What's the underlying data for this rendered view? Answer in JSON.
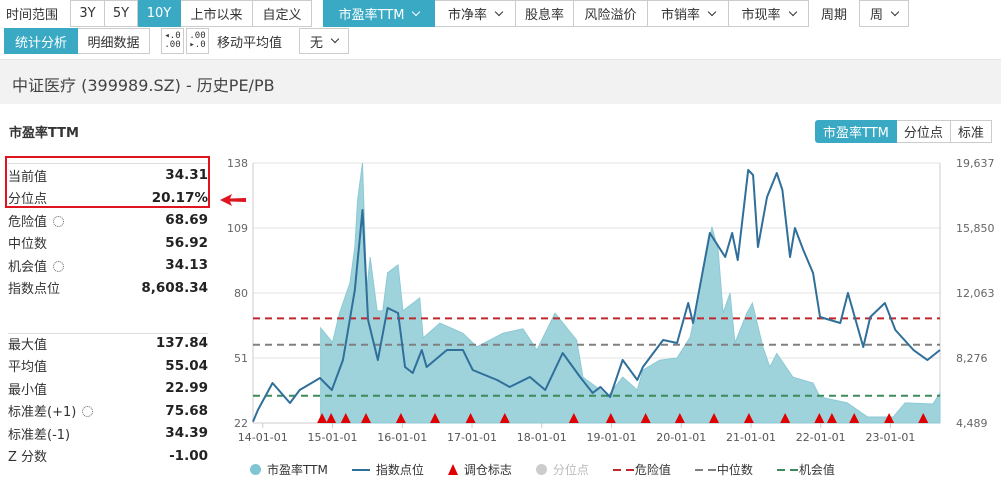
{
  "toolbar": {
    "time_range_label": "时间范围",
    "ranges": [
      "3Y",
      "5Y",
      "10Y",
      "上市以来",
      "自定义"
    ],
    "active_range": "10Y",
    "metrics": [
      "市盈率TTM",
      "市净率",
      "股息率",
      "风险溢价",
      "市销率",
      "市现率"
    ],
    "period_label": "周期",
    "period_value": "周",
    "view_tabs": [
      "统计分析",
      "明细数据"
    ],
    "decimal_increase_icon": ".0 .00",
    "decimal_decrease_icon": ".00 .0",
    "moving_avg_label": "移动平均值",
    "moving_avg_value": "无"
  },
  "header": {
    "title": "中证医疗 (399989.SZ) - 历史PE/PB"
  },
  "section_title": "市盈率TTM",
  "chart_tabs": [
    "市盈率TTM",
    "分位点",
    "标准"
  ],
  "stats": {
    "group1": [
      {
        "label": "当前值",
        "value": "34.31"
      },
      {
        "label": "分位点",
        "value": "20.17%"
      },
      {
        "label": "危险值",
        "value": "68.69",
        "gear": true
      },
      {
        "label": "中位数",
        "value": "56.92"
      },
      {
        "label": "机会值",
        "value": "34.13",
        "gear": true
      },
      {
        "label": "指数点位",
        "value": "8,608.34"
      }
    ],
    "group2": [
      {
        "label": "最大值",
        "value": "137.84"
      },
      {
        "label": "平均值",
        "value": "55.04"
      },
      {
        "label": "最小值",
        "value": "22.99"
      },
      {
        "label": "标准差(+1)",
        "value": "75.68",
        "gear": true
      },
      {
        "label": "标准差(-1)",
        "value": "34.39"
      },
      {
        "label": "Z 分数",
        "value": "-1.00"
      }
    ]
  },
  "colors": {
    "accent": "#3aa9c4",
    "pe_fill": "#9fd3dc",
    "index_line": "#2f6f9a",
    "danger": "#c0282d",
    "median": "#808080",
    "chance": "#3e8a5a",
    "marker": "#e00000",
    "highlight": "#e0141e"
  },
  "chart_data": {
    "type": "area+line",
    "x_unit": "year",
    "xlim": [
      2013.86,
      2023.71
    ],
    "x_ticks": [
      2014,
      2015,
      2016,
      2017,
      2018,
      2019,
      2020,
      2021,
      2022,
      2023
    ],
    "x_tick_labels": [
      "14-01-01",
      "15-01-01",
      "16-01-01",
      "17-01-01",
      "18-01-01",
      "19-01-01",
      "20-01-01",
      "21-01-01",
      "22-01-01",
      "23-01-01"
    ],
    "left_axis": {
      "range": [
        22,
        138
      ],
      "ticks": [
        "138",
        "109",
        "80",
        "51",
        "22"
      ],
      "tick_values": [
        138,
        109,
        80,
        51,
        22
      ]
    },
    "right_axis": {
      "range": [
        4489,
        19637
      ],
      "ticks": [
        "19,637",
        "15,850",
        "12,063",
        "8,276",
        "4,489"
      ],
      "tick_values": [
        19637,
        15850,
        12063,
        8276,
        4489
      ]
    },
    "reference_lines": {
      "danger": 68.69,
      "median": 56.92,
      "chance": 34.13
    },
    "series": [
      {
        "name": "市盈率TTM",
        "axis": "left",
        "type": "area",
        "points": [
          [
            2014.83,
            64.4
          ],
          [
            2015.0,
            58
          ],
          [
            2015.1,
            71
          ],
          [
            2015.25,
            84.5
          ],
          [
            2015.32,
            100.5
          ],
          [
            2015.36,
            121.5
          ],
          [
            2015.43,
            138
          ],
          [
            2015.49,
            81
          ],
          [
            2015.54,
            96
          ],
          [
            2015.64,
            72
          ],
          [
            2015.72,
            72
          ],
          [
            2015.79,
            89
          ],
          [
            2015.94,
            92.5
          ],
          [
            2016.01,
            72
          ],
          [
            2016.25,
            77.8
          ],
          [
            2016.3,
            60
          ],
          [
            2016.54,
            66.6
          ],
          [
            2016.87,
            62
          ],
          [
            2017.07,
            56
          ],
          [
            2017.44,
            62
          ],
          [
            2017.73,
            64
          ],
          [
            2017.93,
            54.6
          ],
          [
            2018.19,
            71
          ],
          [
            2018.5,
            59
          ],
          [
            2018.59,
            42.5
          ],
          [
            2018.84,
            36.7
          ],
          [
            2018.94,
            33.6
          ],
          [
            2019.16,
            42.5
          ],
          [
            2019.37,
            36.7
          ],
          [
            2019.45,
            45.6
          ],
          [
            2019.69,
            50
          ],
          [
            2019.94,
            51
          ],
          [
            2020.13,
            60.4
          ],
          [
            2020.27,
            82.7
          ],
          [
            2020.44,
            109.5
          ],
          [
            2020.53,
            99
          ],
          [
            2020.6,
            71
          ],
          [
            2020.7,
            80
          ],
          [
            2020.77,
            57.7
          ],
          [
            2020.94,
            71
          ],
          [
            2021.02,
            75.5
          ],
          [
            2021.17,
            56
          ],
          [
            2021.27,
            47
          ],
          [
            2021.37,
            53
          ],
          [
            2021.6,
            42.5
          ],
          [
            2021.89,
            39.8
          ],
          [
            2021.99,
            33.6
          ],
          [
            2022.38,
            31
          ],
          [
            2022.67,
            24.7
          ],
          [
            2023.04,
            24.7
          ],
          [
            2023.21,
            31
          ],
          [
            2023.61,
            30.5
          ],
          [
            2023.71,
            35.4
          ]
        ]
      },
      {
        "name": "指数点位",
        "axis": "right",
        "type": "line",
        "points": [
          [
            2013.86,
            4565
          ],
          [
            2013.93,
            5246
          ],
          [
            2014.14,
            6820
          ],
          [
            2014.39,
            5654
          ],
          [
            2014.53,
            6411
          ],
          [
            2014.82,
            7110
          ],
          [
            2014.99,
            6411
          ],
          [
            2015.15,
            8159
          ],
          [
            2015.32,
            12237
          ],
          [
            2015.43,
            16898
          ],
          [
            2015.51,
            10490
          ],
          [
            2015.65,
            8159
          ],
          [
            2015.79,
            11189
          ],
          [
            2015.94,
            10898
          ],
          [
            2016.04,
            7751
          ],
          [
            2016.15,
            7402
          ],
          [
            2016.28,
            8742
          ],
          [
            2016.35,
            7751
          ],
          [
            2016.64,
            8742
          ],
          [
            2016.87,
            8742
          ],
          [
            2017.01,
            7577
          ],
          [
            2017.36,
            6994
          ],
          [
            2017.54,
            6586
          ],
          [
            2017.83,
            7169
          ],
          [
            2018.05,
            6411
          ],
          [
            2018.3,
            8567
          ],
          [
            2018.55,
            7169
          ],
          [
            2018.73,
            6237
          ],
          [
            2018.84,
            6586
          ],
          [
            2018.98,
            6004
          ],
          [
            2019.16,
            8159
          ],
          [
            2019.37,
            6994
          ],
          [
            2019.45,
            7751
          ],
          [
            2019.74,
            9325
          ],
          [
            2019.94,
            9150
          ],
          [
            2020.1,
            11480
          ],
          [
            2020.17,
            10315
          ],
          [
            2020.41,
            15558
          ],
          [
            2020.63,
            14160
          ],
          [
            2020.73,
            15558
          ],
          [
            2020.81,
            13985
          ],
          [
            2020.96,
            19229
          ],
          [
            2021.03,
            18937
          ],
          [
            2021.1,
            14743
          ],
          [
            2021.23,
            17656
          ],
          [
            2021.37,
            19054
          ],
          [
            2021.45,
            18064
          ],
          [
            2021.56,
            14160
          ],
          [
            2021.63,
            15850
          ],
          [
            2021.75,
            14568
          ],
          [
            2021.89,
            13228
          ],
          [
            2021.99,
            10665
          ],
          [
            2022.28,
            10315
          ],
          [
            2022.39,
            12063
          ],
          [
            2022.61,
            8917
          ],
          [
            2022.71,
            10665
          ],
          [
            2022.92,
            11480
          ],
          [
            2023.07,
            9907
          ],
          [
            2023.33,
            8742
          ],
          [
            2023.53,
            8159
          ],
          [
            2023.71,
            8742
          ]
        ]
      },
      {
        "name": "调仓标志",
        "type": "marker",
        "x": [
          2014.85,
          2014.98,
          2015.19,
          2015.48,
          2015.98,
          2016.47,
          2016.98,
          2017.47,
          2018.46,
          2018.99,
          2019.49,
          2019.98,
          2020.47,
          2020.97,
          2021.49,
          2021.98,
          2022.16,
          2022.48,
          2022.98,
          2023.47
        ]
      }
    ],
    "legend": [
      {
        "name": "市盈率TTM",
        "symbol": "circle",
        "enabled": true
      },
      {
        "name": "指数点位",
        "symbol": "line",
        "enabled": true
      },
      {
        "name": "调仓标志",
        "symbol": "triangle",
        "enabled": true
      },
      {
        "name": "分位点",
        "symbol": "circle",
        "enabled": false
      },
      {
        "name": "危险值",
        "symbol": "dash",
        "enabled": true
      },
      {
        "name": "中位数",
        "symbol": "dash",
        "enabled": true
      },
      {
        "name": "机会值",
        "symbol": "dash",
        "enabled": true
      }
    ],
    "legend_position": "bottom"
  }
}
